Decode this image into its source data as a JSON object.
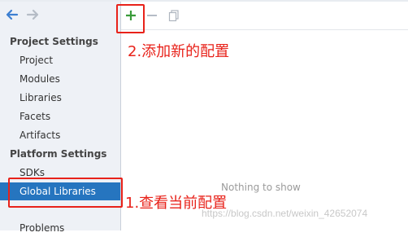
{
  "navigation": {
    "back_icon": "back-arrow-icon",
    "forward_icon": "forward-arrow-icon"
  },
  "sidebar": {
    "sections": [
      {
        "header": "Project Settings",
        "items": [
          "Project",
          "Modules",
          "Libraries",
          "Facets",
          "Artifacts"
        ]
      },
      {
        "header": "Platform Settings",
        "items": [
          "SDKs",
          "Global Libraries"
        ]
      }
    ],
    "selected_item": "Global Libraries",
    "trailing_items": [
      "Problems"
    ]
  },
  "toolbar": {
    "add_icon": "plus-icon",
    "remove_icon": "minus-icon",
    "copy_icon": "copy-icon"
  },
  "main": {
    "empty_text": "Nothing to show"
  },
  "annotations": {
    "add_config": "2.添加新的配置",
    "view_config": "1.查看当前配置"
  },
  "watermark": "https://blog.csdn.net/weixin_42652074",
  "colors": {
    "accent": "#2675bf",
    "annotation_red": "#e8221a",
    "add_green": "#3a9b3a"
  }
}
